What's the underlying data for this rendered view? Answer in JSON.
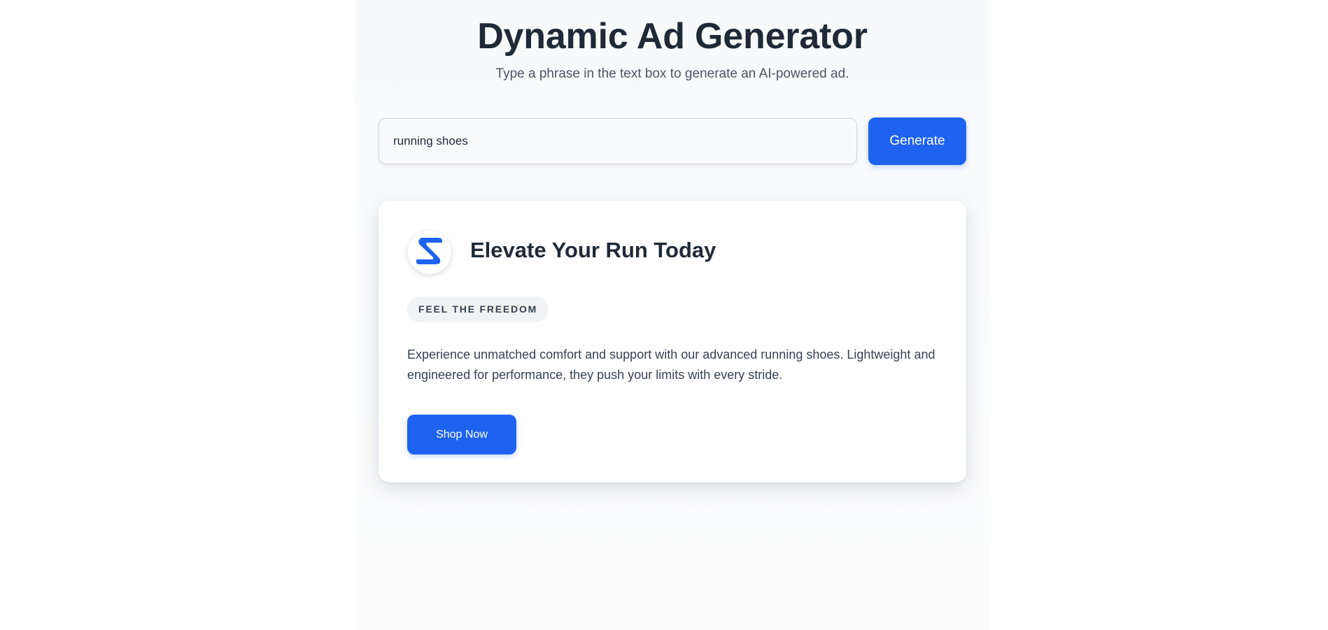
{
  "header": {
    "title": "Dynamic Ad Generator",
    "subtitle": "Type a phrase in the text box to generate an AI-powered ad."
  },
  "search": {
    "value": "running shoes",
    "placeholder": ""
  },
  "generate_button": {
    "label": "Generate"
  },
  "ad": {
    "logo_icon": "brand-s-logo-icon",
    "headline": "Elevate Your Run Today",
    "tagline": "FEEL THE FREEDOM",
    "body": "Experience unmatched comfort and support with our advanced running shoes. Lightweight and engineered for performance, they push your limits with every stride.",
    "cta_label": "Shop Now"
  },
  "colors": {
    "accent": "#1e63f0",
    "title_text": "#1f2937",
    "body_text": "#374151",
    "subtitle_text": "#4b5563",
    "tag_background": "#f1f2f4"
  }
}
